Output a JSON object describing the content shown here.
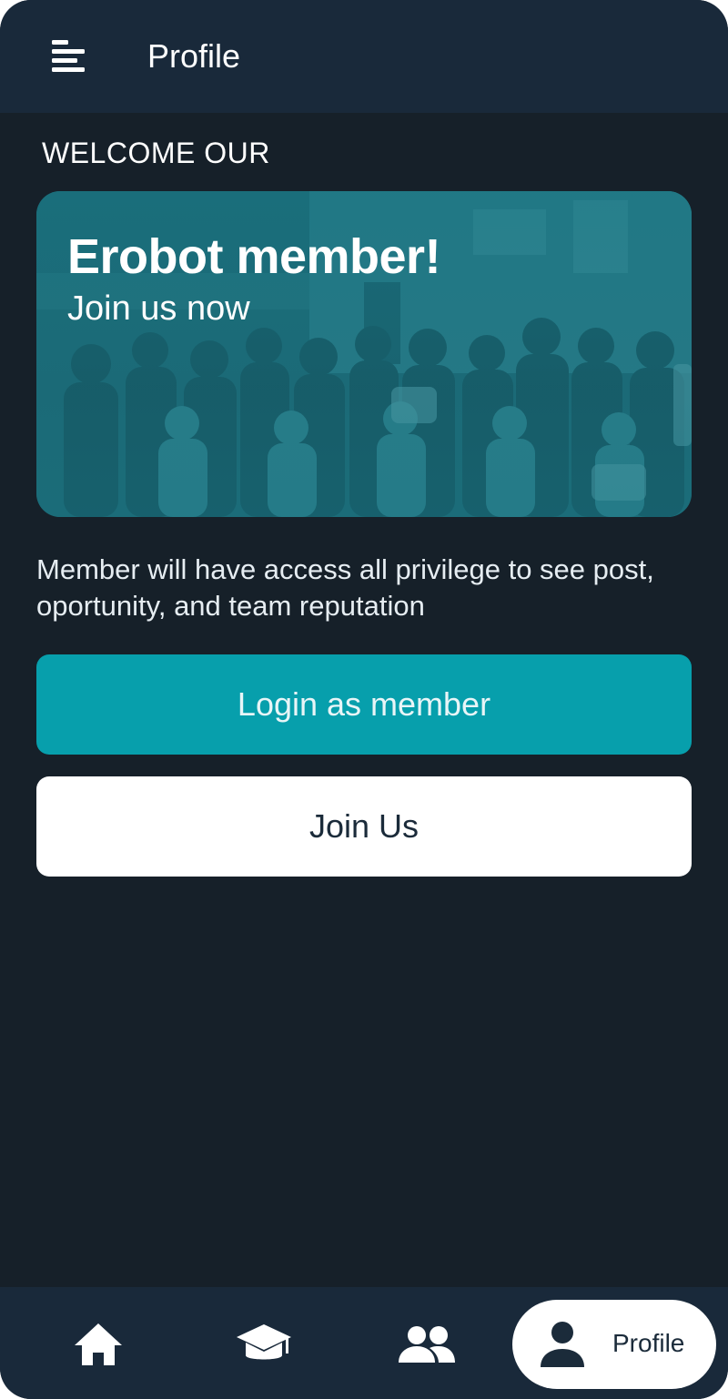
{
  "app_bar": {
    "title": "Profile",
    "menu_icon": "menu-icon"
  },
  "welcome": {
    "heading": "WELCOME OUR"
  },
  "banner": {
    "title": "Erobot member!",
    "subtitle": "Join us now",
    "overlay_color": "#187684"
  },
  "description": {
    "text": "Member will have access all privilege to see post, oportunity, and team reputation"
  },
  "buttons": {
    "login_label": "Login as member",
    "join_label": "Join Us"
  },
  "bottom_nav": {
    "items": [
      {
        "icon": "home-icon"
      },
      {
        "icon": "graduation-cap-icon"
      },
      {
        "icon": "group-icon"
      },
      {
        "icon": "person-icon",
        "label": "Profile",
        "active": true
      }
    ]
  },
  "colors": {
    "background": "#162029",
    "app_bar": "#19293a",
    "primary_button": "#079fac",
    "secondary_button": "#ffffff",
    "text_dark": "#1b2b3a"
  }
}
